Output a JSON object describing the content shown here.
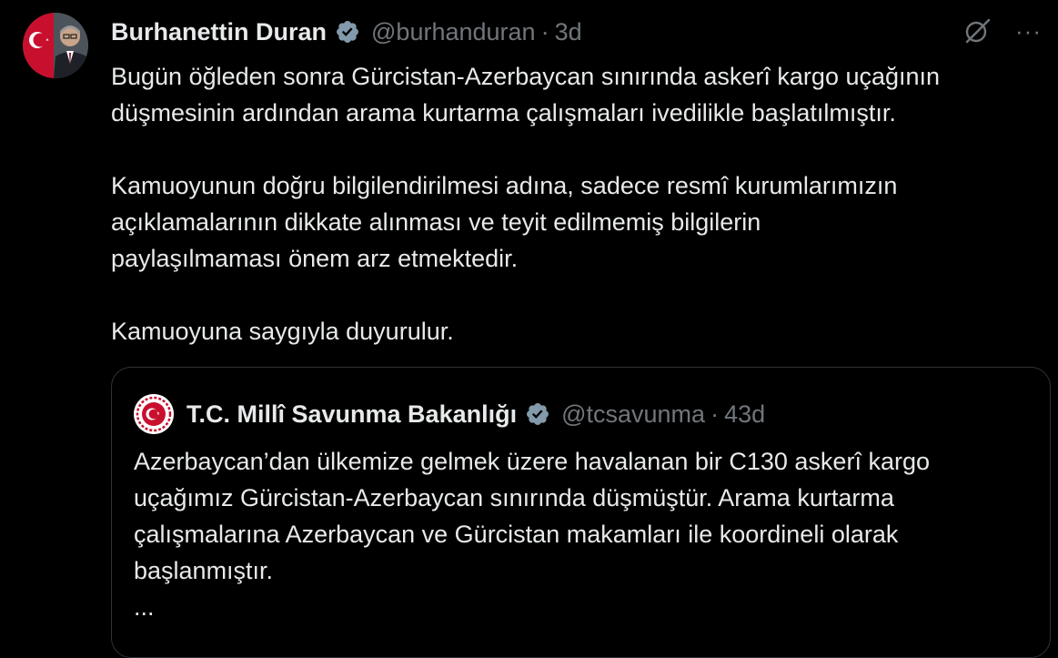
{
  "author": {
    "name": "Burhanettin Duran",
    "handle": "@burhanduran",
    "separator": "·",
    "time": "3d"
  },
  "icons": {
    "verified": "verified-badge-icon",
    "grok": "grok-icon",
    "more": "more-options-icon",
    "more_glyph": "···"
  },
  "tweet": {
    "paragraphs": [
      "Bugün öğleden sonra Gürcistan-Azerbaycan sınırında askerî kargo uçağının\ndüşmesinin ardından arama kurtarma çalışmaları ivedilikle başlatılmıştır.",
      "Kamuoyunun doğru bilgilendirilmesi adına, sadece resmî kurumlarımızın\naçıklamalarının dikkate alınması ve teyit edilmemiş bilgilerin\npaylaşılmaması önem arz etmektedir.",
      "Kamuoyuna saygıyla duyurulur."
    ]
  },
  "quote": {
    "name": "T.C. Millî Savunma Bakanlığı",
    "handle": "@tcsavunma",
    "separator": "·",
    "time": "43d",
    "text": "Azerbaycan’dan ülkemize gelmek üzere havalanan bir C130 askerî kargo\nuçağımız Gürcistan-Azerbaycan sınırında düşmüştür. Arama kurtarma\nçalışmalarına Azerbaycan ve Gürcistan makamları ile koordineli olarak\nbaşlanmıştır.",
    "ellipsis": "..."
  },
  "colors": {
    "background": "#000000",
    "text": "#e7e9ea",
    "muted": "#71767b",
    "verified": "#829aab",
    "border": "#2f3336"
  }
}
